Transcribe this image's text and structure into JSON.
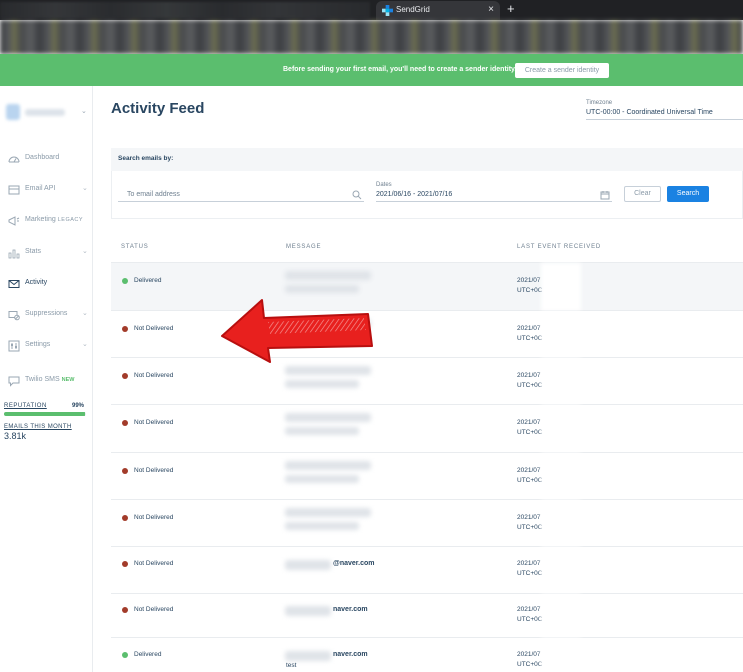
{
  "browser": {
    "tab_title": "SendGrid",
    "close_glyph": "×",
    "new_tab_glyph": "+"
  },
  "banner": {
    "text": "Before sending your first email, you'll need to create a sender identity.",
    "button_label": "Create a sender identity",
    "color": "#5bbe6e"
  },
  "sidebar": {
    "items": [
      {
        "label": "Dashboard",
        "icon": "speedometer-icon",
        "chevron": false
      },
      {
        "label": "Email API",
        "icon": "email-api-icon",
        "chevron": true
      },
      {
        "label": "Marketing",
        "tag": "LEGACY",
        "icon": "megaphone-icon",
        "chevron": true
      },
      {
        "label": "Stats",
        "icon": "bar-chart-icon",
        "chevron": true
      },
      {
        "label": "Activity",
        "icon": "envelope-icon",
        "chevron": false,
        "active": true
      },
      {
        "label": "Suppressions",
        "icon": "suppressions-icon",
        "chevron": true
      },
      {
        "label": "Settings",
        "icon": "settings-icon",
        "chevron": true
      },
      {
        "label": "Twilio SMS",
        "tag": "NEW",
        "icon": "chat-icon",
        "chevron": false
      }
    ],
    "reputation_label": "REPUTATION",
    "reputation_value": "99%",
    "reputation_fraction": 0.99,
    "emails_label": "EMAILS THIS MONTH",
    "emails_value": "3.81k"
  },
  "main": {
    "title": "Activity Feed",
    "timezone_label": "Timezone",
    "timezone_value": "UTC-00:00 - Coordinated Universal Time",
    "search": {
      "title": "Search emails by:",
      "email_placeholder": "To email address",
      "dates_label": "Dates",
      "dates_value": "2021/06/16 - 2021/07/16",
      "clear_label": "Clear",
      "search_label": "Search"
    },
    "columns": [
      "STATUS",
      "MESSAGE",
      "LAST EVENT RECEIVED"
    ],
    "rows": [
      {
        "status": "Delivered",
        "status_color": "#5bbe6e",
        "message": "",
        "message_sub": "",
        "event_date": "2021/07",
        "event_tz": "UTC+0C"
      },
      {
        "status": "Not Delivered",
        "status_color": "#a23b2a",
        "message": "",
        "message_sub": "",
        "event_date": "2021/07",
        "event_tz": "UTC+0C"
      },
      {
        "status": "Not Delivered",
        "status_color": "#a23b2a",
        "message": "",
        "message_sub": "",
        "event_date": "2021/07",
        "event_tz": "UTC+0C"
      },
      {
        "status": "Not Delivered",
        "status_color": "#a23b2a",
        "message": "",
        "message_sub": "",
        "event_date": "2021/07",
        "event_tz": "UTC+0C"
      },
      {
        "status": "Not Delivered",
        "status_color": "#a23b2a",
        "message": "",
        "message_sub": "",
        "event_date": "2021/07",
        "event_tz": "UTC+0C"
      },
      {
        "status": "Not Delivered",
        "status_color": "#a23b2a",
        "message": "",
        "message_sub": "",
        "event_date": "2021/07",
        "event_tz": "UTC+0C"
      },
      {
        "status": "Not Delivered",
        "status_color": "#a23b2a",
        "message": "@naver.com",
        "message_sub": "",
        "event_date": "2021/07",
        "event_tz": "UTC+0C"
      },
      {
        "status": "Not Delivered",
        "status_color": "#a23b2a",
        "message": "naver.com",
        "message_sub": "",
        "event_date": "2021/07",
        "event_tz": "UTC+0C"
      },
      {
        "status": "Delivered",
        "status_color": "#5bbe6e",
        "message": "naver.com",
        "message_sub": "test",
        "event_date": "2021/07",
        "event_tz": "UTC+0C"
      }
    ]
  },
  "annotation": {
    "shape": "red-arrow-icon",
    "color": "#e8201e"
  }
}
